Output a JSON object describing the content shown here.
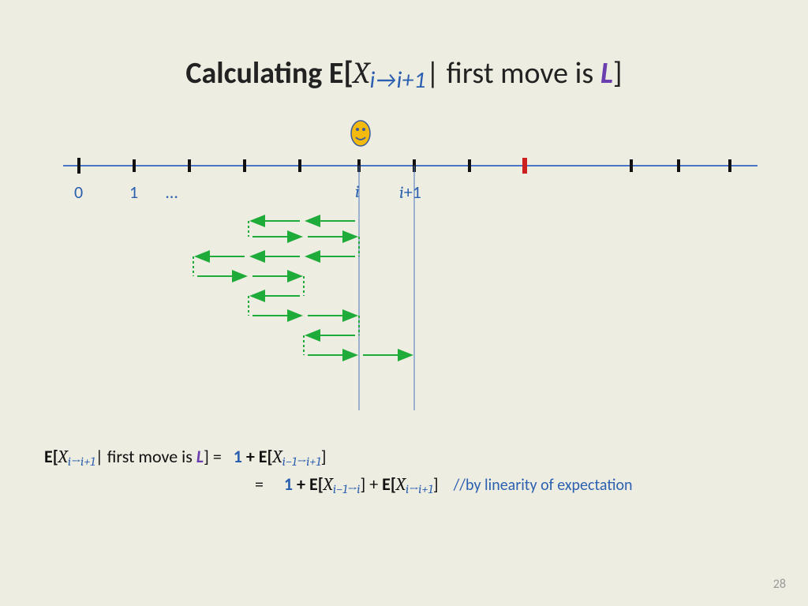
{
  "title": {
    "prefix_bold": "Calculating E[",
    "var": "X",
    "sub": "i→i+1",
    "mid": "| first move is ",
    "L": "L",
    "suffix": "]"
  },
  "axis": {
    "labels": {
      "zero": "0",
      "one": "1",
      "dots": "…",
      "i": "i",
      "iplus1": "i+1"
    }
  },
  "equations": {
    "lhs_E": "E[",
    "lhs_var": "X",
    "lhs_sub": "i→i+1",
    "lhs_mid": "| first move is ",
    "lhs_L": "L",
    "lhs_close": "] =",
    "rhs1_one": "1",
    "rhs1_plus": " + ",
    "rhs1_E": "E[",
    "rhs1_var": "X",
    "rhs1_sub": "i−1→i+1",
    "rhs1_close": "]",
    "row2_eq": "=",
    "rhs2_one": "1",
    "rhs2_plus1": " + ",
    "rhs2_E1": "E[",
    "rhs2_var1": "X",
    "rhs2_sub1": "i−1→i",
    "rhs2_close1": "] + ",
    "rhs2_E2": "E[",
    "rhs2_var2": "X",
    "rhs2_sub2": "i→i+1",
    "rhs2_close2": "]",
    "comment": "//by linearity of expectation"
  },
  "page_number": "28"
}
